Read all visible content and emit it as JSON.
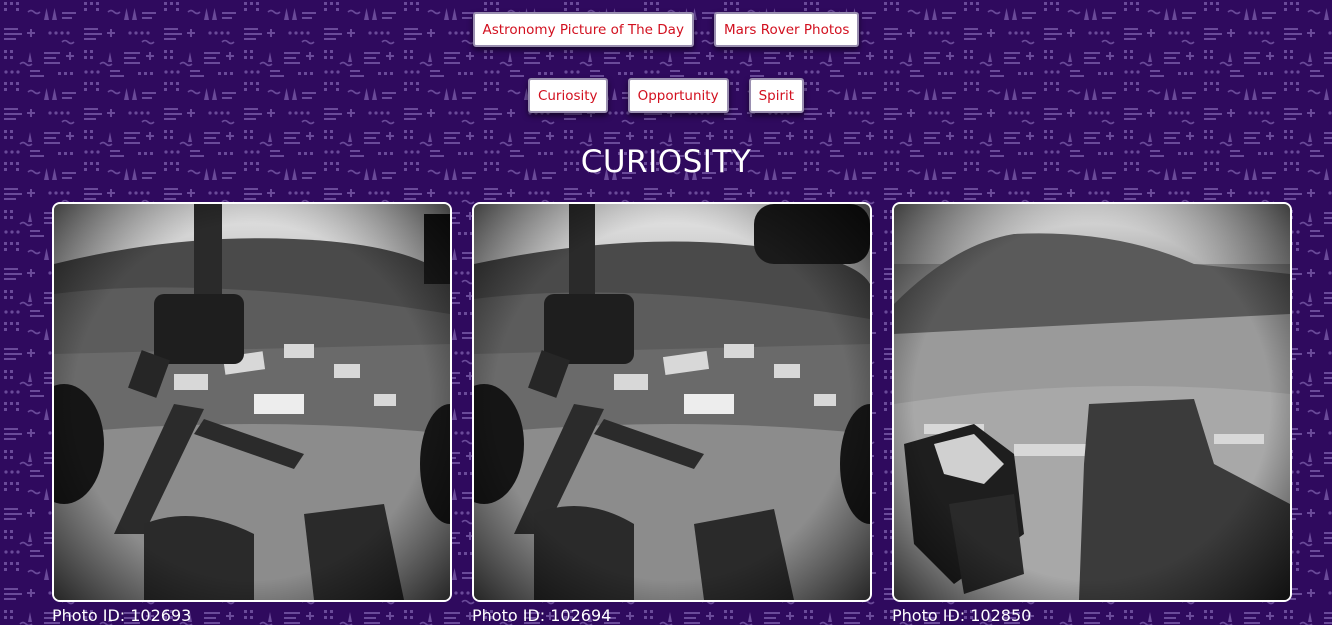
{
  "nav": {
    "apod_label": "Astronomy Picture of The Day",
    "mars_label": "Mars Rover Photos"
  },
  "rovers": {
    "curiosity_label": "Curiosity",
    "opportunity_label": "Opportunity",
    "spirit_label": "Spirit"
  },
  "page": {
    "rover_title": "CURIOSITY"
  },
  "photos": [
    {
      "caption": "Photo ID: 102693",
      "camera_view": "front hazcam with robotic arm"
    },
    {
      "caption": "Photo ID: 102694",
      "camera_view": "front hazcam with robotic arm"
    },
    {
      "caption": "Photo ID: 102850",
      "camera_view": "rear hazcam with wheel"
    }
  ],
  "colors": {
    "background": "#2f0a5e",
    "pattern": "#6a4a99",
    "button_text": "#d2101f",
    "title_text": "#ffffff"
  }
}
